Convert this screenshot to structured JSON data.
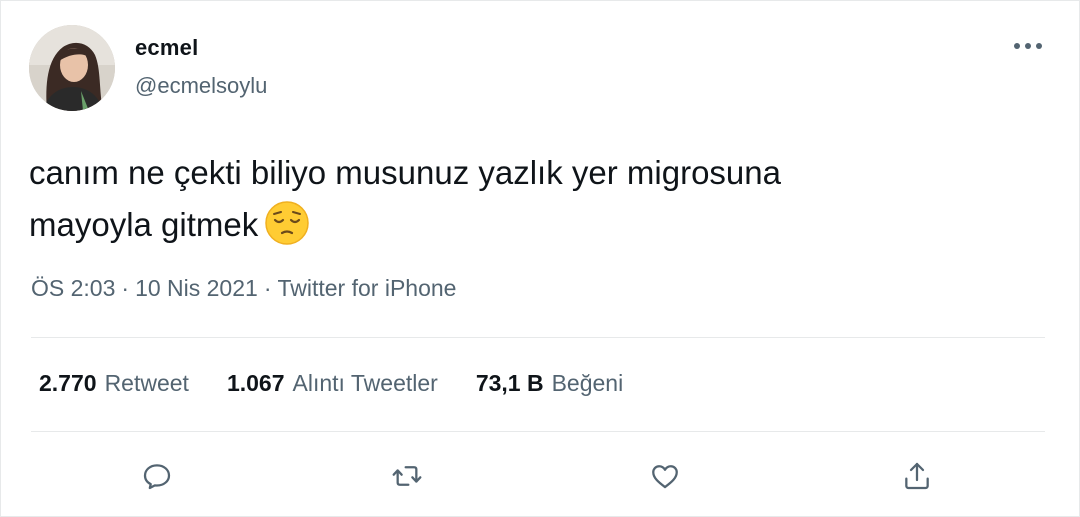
{
  "tweet": {
    "author": {
      "display_name": "ecmel",
      "handle": "@ecmelsoylu",
      "avatar_icon": "profile-photo"
    },
    "text_line1": "canım ne çekti biliyo musunuz yazlık yer migrosuna",
    "text_line2": "mayoyla gitmek",
    "emoji": "pensive-face-emoji",
    "time": "ÖS 2:03",
    "date": "10 Nis 2021",
    "separator": "·",
    "source": "Twitter for iPhone"
  },
  "stats": {
    "retweets_count": "2.770",
    "retweets_label": "Retweet",
    "quotes_count": "1.067",
    "quotes_label": "Alıntı Tweetler",
    "likes_count": "73,1 B",
    "likes_label": "Beğeni"
  },
  "actions": {
    "reply_icon": "reply-icon",
    "retweet_icon": "retweet-icon",
    "like_icon": "heart-icon",
    "share_icon": "share-icon"
  },
  "colors": {
    "text_primary": "#0f1419",
    "text_secondary": "#536471",
    "divider": "#e7e9ea"
  }
}
